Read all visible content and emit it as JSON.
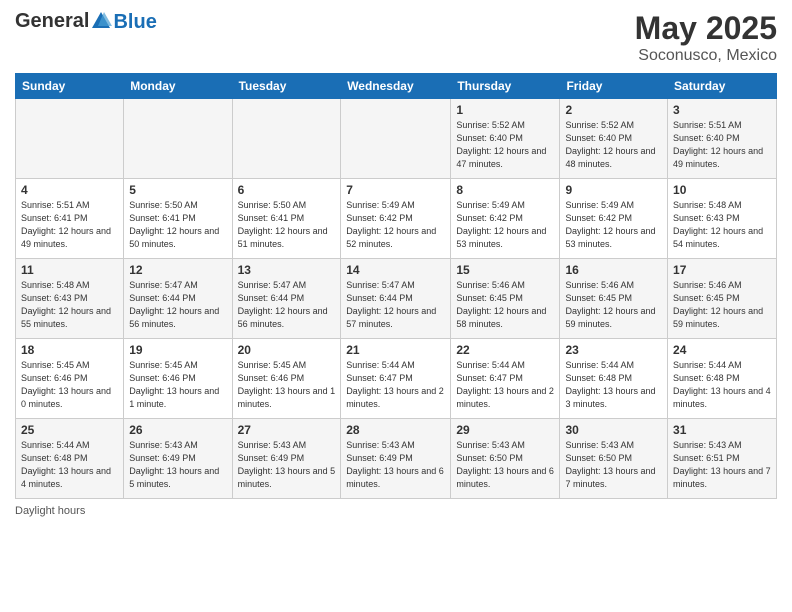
{
  "header": {
    "logo_general": "General",
    "logo_blue": "Blue",
    "month_year": "May 2025",
    "location": "Soconusco, Mexico"
  },
  "days_of_week": [
    "Sunday",
    "Monday",
    "Tuesday",
    "Wednesday",
    "Thursday",
    "Friday",
    "Saturday"
  ],
  "weeks": [
    [
      {
        "day": "",
        "info": ""
      },
      {
        "day": "",
        "info": ""
      },
      {
        "day": "",
        "info": ""
      },
      {
        "day": "",
        "info": ""
      },
      {
        "day": "1",
        "info": "Sunrise: 5:52 AM\nSunset: 6:40 PM\nDaylight: 12 hours and 47 minutes."
      },
      {
        "day": "2",
        "info": "Sunrise: 5:52 AM\nSunset: 6:40 PM\nDaylight: 12 hours and 48 minutes."
      },
      {
        "day": "3",
        "info": "Sunrise: 5:51 AM\nSunset: 6:40 PM\nDaylight: 12 hours and 49 minutes."
      }
    ],
    [
      {
        "day": "4",
        "info": "Sunrise: 5:51 AM\nSunset: 6:41 PM\nDaylight: 12 hours and 49 minutes."
      },
      {
        "day": "5",
        "info": "Sunrise: 5:50 AM\nSunset: 6:41 PM\nDaylight: 12 hours and 50 minutes."
      },
      {
        "day": "6",
        "info": "Sunrise: 5:50 AM\nSunset: 6:41 PM\nDaylight: 12 hours and 51 minutes."
      },
      {
        "day": "7",
        "info": "Sunrise: 5:49 AM\nSunset: 6:42 PM\nDaylight: 12 hours and 52 minutes."
      },
      {
        "day": "8",
        "info": "Sunrise: 5:49 AM\nSunset: 6:42 PM\nDaylight: 12 hours and 53 minutes."
      },
      {
        "day": "9",
        "info": "Sunrise: 5:49 AM\nSunset: 6:42 PM\nDaylight: 12 hours and 53 minutes."
      },
      {
        "day": "10",
        "info": "Sunrise: 5:48 AM\nSunset: 6:43 PM\nDaylight: 12 hours and 54 minutes."
      }
    ],
    [
      {
        "day": "11",
        "info": "Sunrise: 5:48 AM\nSunset: 6:43 PM\nDaylight: 12 hours and 55 minutes."
      },
      {
        "day": "12",
        "info": "Sunrise: 5:47 AM\nSunset: 6:44 PM\nDaylight: 12 hours and 56 minutes."
      },
      {
        "day": "13",
        "info": "Sunrise: 5:47 AM\nSunset: 6:44 PM\nDaylight: 12 hours and 56 minutes."
      },
      {
        "day": "14",
        "info": "Sunrise: 5:47 AM\nSunset: 6:44 PM\nDaylight: 12 hours and 57 minutes."
      },
      {
        "day": "15",
        "info": "Sunrise: 5:46 AM\nSunset: 6:45 PM\nDaylight: 12 hours and 58 minutes."
      },
      {
        "day": "16",
        "info": "Sunrise: 5:46 AM\nSunset: 6:45 PM\nDaylight: 12 hours and 59 minutes."
      },
      {
        "day": "17",
        "info": "Sunrise: 5:46 AM\nSunset: 6:45 PM\nDaylight: 12 hours and 59 minutes."
      }
    ],
    [
      {
        "day": "18",
        "info": "Sunrise: 5:45 AM\nSunset: 6:46 PM\nDaylight: 13 hours and 0 minutes."
      },
      {
        "day": "19",
        "info": "Sunrise: 5:45 AM\nSunset: 6:46 PM\nDaylight: 13 hours and 1 minute."
      },
      {
        "day": "20",
        "info": "Sunrise: 5:45 AM\nSunset: 6:46 PM\nDaylight: 13 hours and 1 minutes."
      },
      {
        "day": "21",
        "info": "Sunrise: 5:44 AM\nSunset: 6:47 PM\nDaylight: 13 hours and 2 minutes."
      },
      {
        "day": "22",
        "info": "Sunrise: 5:44 AM\nSunset: 6:47 PM\nDaylight: 13 hours and 2 minutes."
      },
      {
        "day": "23",
        "info": "Sunrise: 5:44 AM\nSunset: 6:48 PM\nDaylight: 13 hours and 3 minutes."
      },
      {
        "day": "24",
        "info": "Sunrise: 5:44 AM\nSunset: 6:48 PM\nDaylight: 13 hours and 4 minutes."
      }
    ],
    [
      {
        "day": "25",
        "info": "Sunrise: 5:44 AM\nSunset: 6:48 PM\nDaylight: 13 hours and 4 minutes."
      },
      {
        "day": "26",
        "info": "Sunrise: 5:43 AM\nSunset: 6:49 PM\nDaylight: 13 hours and 5 minutes."
      },
      {
        "day": "27",
        "info": "Sunrise: 5:43 AM\nSunset: 6:49 PM\nDaylight: 13 hours and 5 minutes."
      },
      {
        "day": "28",
        "info": "Sunrise: 5:43 AM\nSunset: 6:49 PM\nDaylight: 13 hours and 6 minutes."
      },
      {
        "day": "29",
        "info": "Sunrise: 5:43 AM\nSunset: 6:50 PM\nDaylight: 13 hours and 6 minutes."
      },
      {
        "day": "30",
        "info": "Sunrise: 5:43 AM\nSunset: 6:50 PM\nDaylight: 13 hours and 7 minutes."
      },
      {
        "day": "31",
        "info": "Sunrise: 5:43 AM\nSunset: 6:51 PM\nDaylight: 13 hours and 7 minutes."
      }
    ]
  ],
  "footer": {
    "daylight_label": "Daylight hours"
  }
}
